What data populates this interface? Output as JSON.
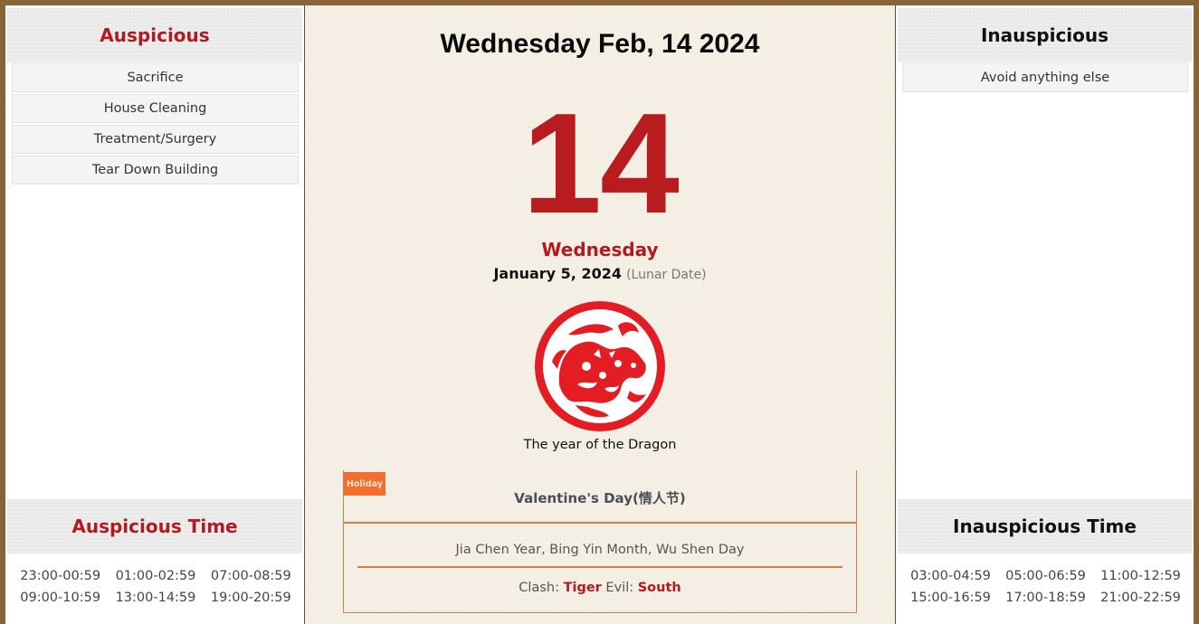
{
  "auspicious": {
    "title": "Auspicious",
    "items": [
      "Sacrifice",
      "House Cleaning",
      "Treatment/Surgery",
      "Tear Down Building"
    ],
    "time_title": "Auspicious Time",
    "times": [
      "23:00-00:59",
      "01:00-02:59",
      "07:00-08:59",
      "09:00-10:59",
      "13:00-14:59",
      "19:00-20:59"
    ]
  },
  "inauspicious": {
    "title": "Inauspicious",
    "items": [
      "Avoid anything else"
    ],
    "time_title": "Inauspicious Time",
    "times": [
      "03:00-04:59",
      "05:00-06:59",
      "11:00-12:59",
      "15:00-16:59",
      "17:00-18:59",
      "21:00-22:59"
    ]
  },
  "day": {
    "title": "Wednesday Feb, 14 2024",
    "number": "14",
    "weekday": "Wednesday",
    "lunar_date": "January 5, 2024",
    "lunar_note": "(Lunar Date)",
    "zodiac_icon": "dragon-papercut-icon",
    "zodiac_caption": "The year of the Dragon"
  },
  "holiday": {
    "tag": "Holiday",
    "name": "Valentine's Day(情人节)"
  },
  "ganzhi": "Jia Chen Year, Bing Yin Month, Wu Shen Day",
  "clash": {
    "clash_label": "Clash:",
    "clash_value": "Tiger",
    "evil_label": "Evil:",
    "evil_value": "South"
  },
  "colors": {
    "accent_red": "#b11a1e",
    "frame_brown": "#8c6239",
    "holiday_orange": "#f26e2f"
  }
}
